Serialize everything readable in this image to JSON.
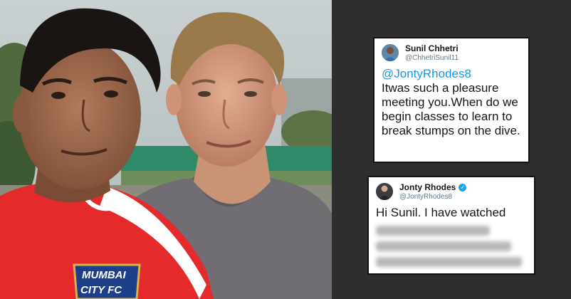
{
  "photo": {
    "crest_line1": "MUMBAI",
    "crest_line2": "CITY FC"
  },
  "tweets": [
    {
      "name": "Sunil Chhetri",
      "handle": "@ChhetriSunil11",
      "verified": false,
      "mention": "@JontyRhodes8",
      "text": "Itwas such a pleasure meeting you.When do we begin classes to learn to break stumps on the dive."
    },
    {
      "name": "Jonty Rhodes",
      "handle": "@JontyRhodes8",
      "verified": true,
      "verified_icon": "✓",
      "text": "Hi Sunil. I have watched",
      "blurred_line_count": 3
    }
  ],
  "colors": {
    "background": "#2e2e2e",
    "mention": "#1b95e0",
    "verified": "#1da1f2",
    "jersey_red": "#e42a2a"
  }
}
